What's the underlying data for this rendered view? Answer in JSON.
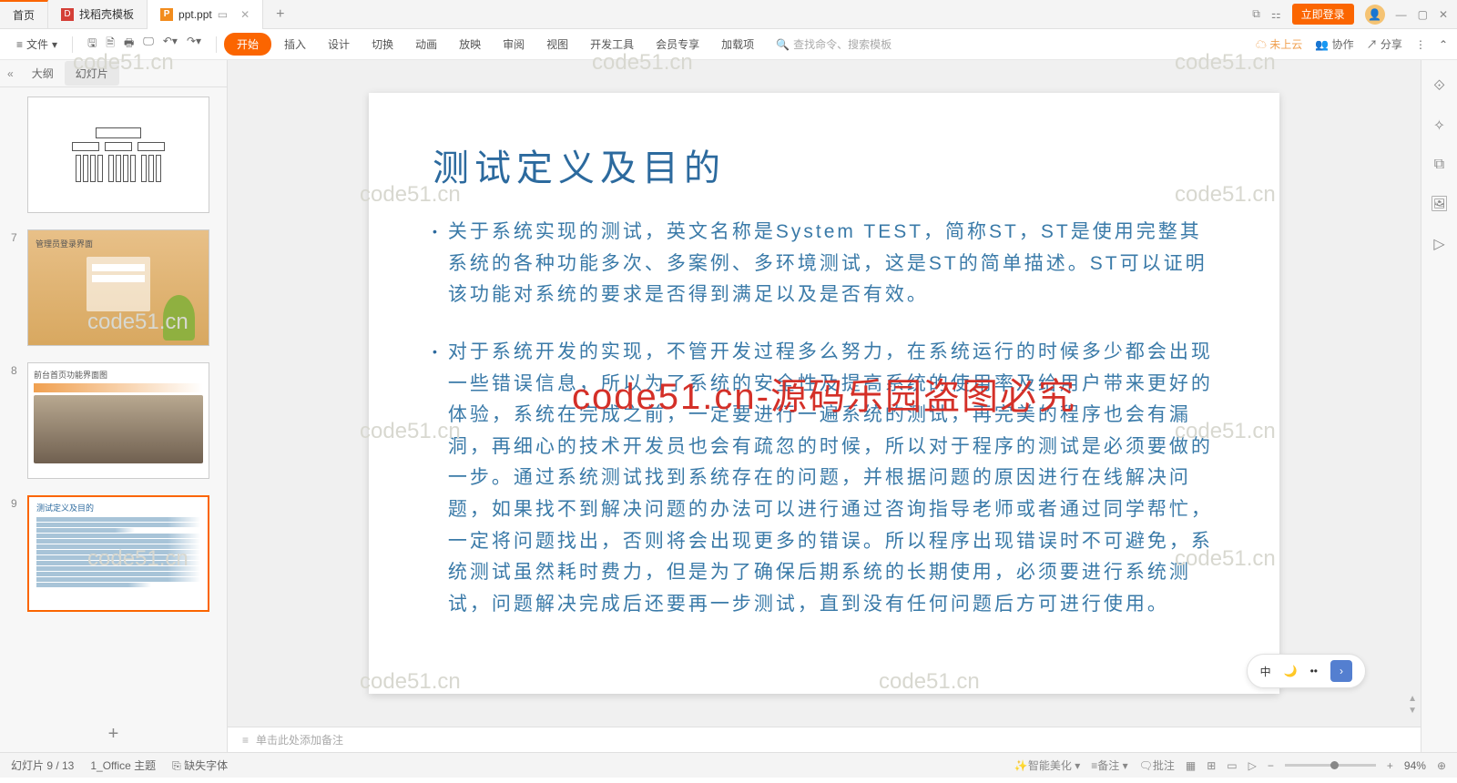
{
  "tabs": {
    "home": "首页",
    "template": "找稻壳模板",
    "file": "ppt.ppt"
  },
  "window": {
    "login": "立即登录"
  },
  "menubar": {
    "file": "文件",
    "tabs": {
      "start": "开始",
      "insert": "插入",
      "design": "设计",
      "transition": "切换",
      "animation": "动画",
      "show": "放映",
      "review": "审阅",
      "view": "视图",
      "devtools": "开发工具",
      "vip": "会员专享",
      "addin": "加载项"
    },
    "search_placeholder": "查找命令、搜索模板",
    "right": {
      "cloud": "未上云",
      "collab": "协作",
      "share": "分享"
    }
  },
  "leftpanel": {
    "views": {
      "outline": "大纲",
      "slide": "幻灯片"
    },
    "thumbs": {
      "t7": "管理员登录界面",
      "t8": "前台首页功能界面图",
      "t9": "测试定义及目的"
    }
  },
  "slide": {
    "title": "测试定义及目的",
    "b1": "关于系统实现的测试，英文名称是System TEST，简称ST，ST是使用完整其系统的各种功能多次、多案例、多环境测试，这是ST的简单描述。ST可以证明该功能对系统的要求是否得到满足以及是否有效。",
    "b2": "对于系统开发的实现，不管开发过程多么努力，在系统运行的时候多少都会出现一些错误信息，所以为了系统的安全性及提高系统的使用率及给用户带来更好的体验，系统在完成之前，一定要进行一遍系统的测试，再完美的程序也会有漏洞，再细心的技术开发员也会有疏忽的时候，所以对于程序的测试是必须要做的一步。通过系统测试找到系统存在的问题，并根据问题的原因进行在线解决问题，如果找不到解决问题的办法可以进行通过咨询指导老师或者通过同学帮忙，一定将问题找出，否则将会出现更多的错误。所以程序出现错误时不可避免，系统测试虽然耗时费力，但是为了确保后期系统的长期使用，必须要进行系统测试，问题解决完成后还要再一步测试，直到没有任何问题后方可进行使用。"
  },
  "notes": {
    "placeholder": "单击此处添加备注"
  },
  "statusbar": {
    "slidecount": "幻灯片 9 / 13",
    "theme": "1_Office 主题",
    "missingfont": "缺失字体",
    "beautify": "智能美化",
    "notes": "备注",
    "comments": "批注",
    "zoom": "94%"
  },
  "watermark": "code51.cn",
  "overlay": "code51.cn-源码乐园盗图必究",
  "float": {
    "cn": "中"
  }
}
